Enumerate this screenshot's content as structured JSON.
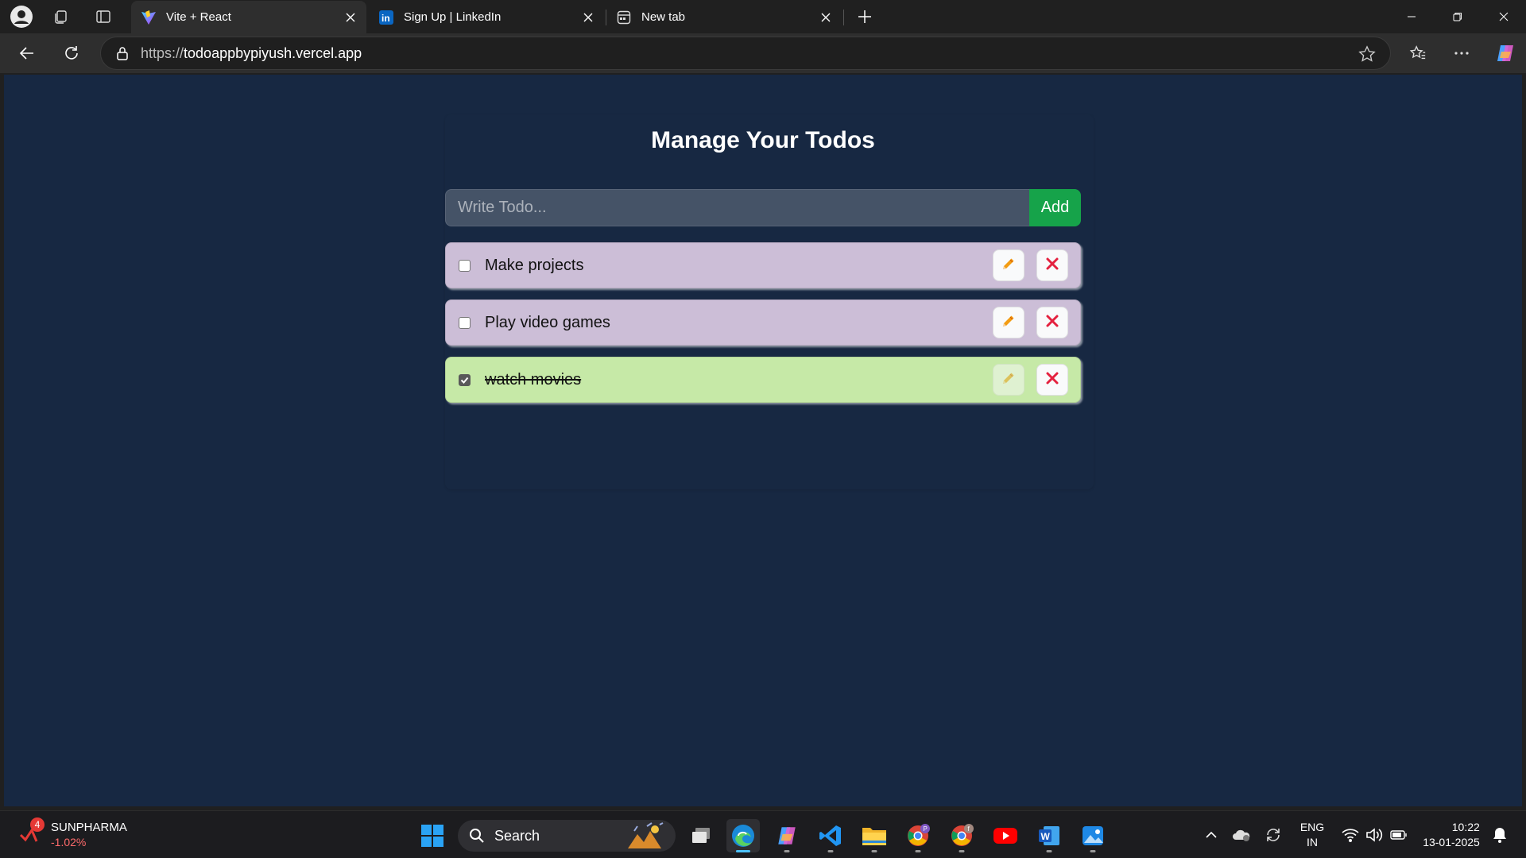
{
  "browser": {
    "tabs": [
      {
        "title": "Vite + React",
        "icon": "vite-icon",
        "active": true
      },
      {
        "title": "Sign Up | LinkedIn",
        "icon": "linkedin-icon",
        "active": false
      },
      {
        "title": "New tab",
        "icon": "new-tab-page-icon",
        "active": false
      }
    ],
    "url_protocol": "https://",
    "url_host": "todoappbypiyush.vercel.app"
  },
  "app": {
    "title": "Manage Your Todos",
    "input_placeholder": "Write Todo...",
    "add_label": "Add",
    "todos": [
      {
        "text": "Make projects",
        "completed": false
      },
      {
        "text": "Play video games",
        "completed": false
      },
      {
        "text": "watch movies",
        "completed": true
      }
    ],
    "colors": {
      "pending": "#ccbed7",
      "completed": "#c6e9a7",
      "add_button": "#16a34a",
      "page_bg": "#172842"
    }
  },
  "taskbar": {
    "stock_name": "SUNPHARMA",
    "stock_change": "-1.02%",
    "stock_badge": "4",
    "search_label": "Search",
    "language_line1": "ENG",
    "language_line2": "IN",
    "time": "10:22",
    "date": "13-01-2025",
    "apps": [
      "windows-start-icon",
      "search-icon",
      "task-view-icon",
      "edge-icon",
      "copilot-icon",
      "vscode-icon",
      "file-explorer-icon",
      "chrome-profile-p-icon",
      "chrome-profile-f-icon",
      "youtube-icon",
      "word-icon",
      "photos-icon"
    ],
    "profile_badges": [
      "P",
      "f"
    ]
  }
}
